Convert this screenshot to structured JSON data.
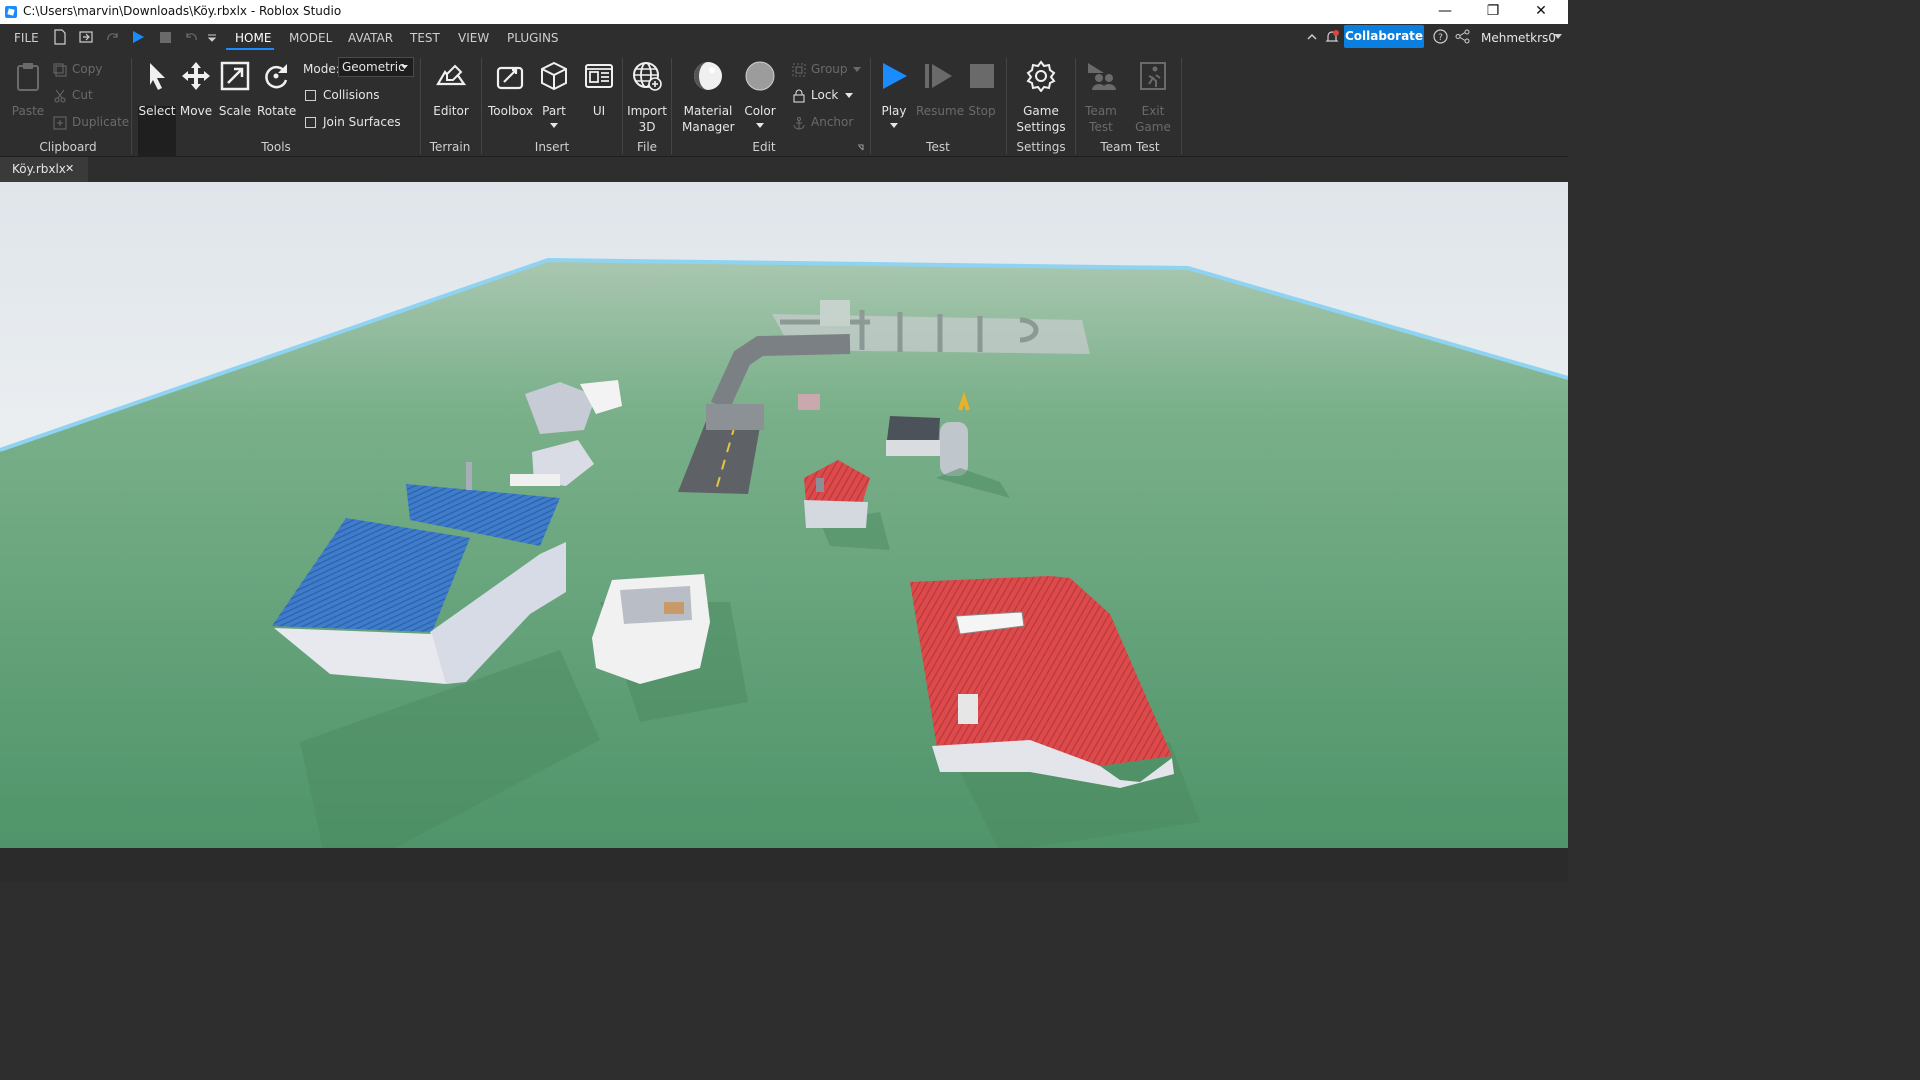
{
  "window": {
    "title": "C:\\Users\\marvin\\Downloads\\Köy.rbxlx - Roblox Studio",
    "minimize": "—",
    "restore": "❐",
    "close": "✕"
  },
  "menu": {
    "file": "FILE",
    "tabs": [
      "HOME",
      "MODEL",
      "AVATAR",
      "TEST",
      "VIEW",
      "PLUGINS"
    ],
    "active_tab": "HOME",
    "collaborate": "Collaborate",
    "username": "Mehmetkrs0"
  },
  "ribbon": {
    "clipboard": {
      "paste": "Paste",
      "copy": "Copy",
      "cut": "Cut",
      "duplicate": "Duplicate",
      "label": "Clipboard"
    },
    "tools": {
      "select": "Select",
      "move": "Move",
      "scale": "Scale",
      "rotate": "Rotate",
      "mode_label": "Mode:",
      "mode_value": "Geometric",
      "collisions": "Collisions",
      "join_surfaces": "Join Surfaces",
      "label": "Tools"
    },
    "terrain": {
      "editor": "Editor",
      "label": "Terrain"
    },
    "insert": {
      "toolbox": "Toolbox",
      "part": "Part",
      "ui": "UI",
      "label": "Insert"
    },
    "file": {
      "import_line1": "Import",
      "import_line2": "3D",
      "label": "File"
    },
    "edit": {
      "material_line1": "Material",
      "material_line2": "Manager",
      "color": "Color",
      "group": "Group",
      "lock": "Lock",
      "anchor": "Anchor",
      "label": "Edit"
    },
    "test": {
      "play": "Play",
      "resume": "Resume",
      "stop": "Stop",
      "label": "Test"
    },
    "settings": {
      "game_line1": "Game",
      "game_line2": "Settings",
      "label": "Settings"
    },
    "team_test": {
      "team_line1": "Team",
      "team_line2": "Test",
      "exit_line1": "Exit",
      "exit_line2": "Game",
      "label": "Team Test"
    }
  },
  "document_tab": {
    "name": "Köy.rbxlx",
    "close": "✕"
  },
  "colors": {
    "accent": "#1a8cff",
    "collaborate": "#0b7fe0",
    "ground": "#5a9a6a",
    "sky": "#e9eef2",
    "roof_blue": "#3c78c8",
    "roof_red": "#d9494a"
  }
}
